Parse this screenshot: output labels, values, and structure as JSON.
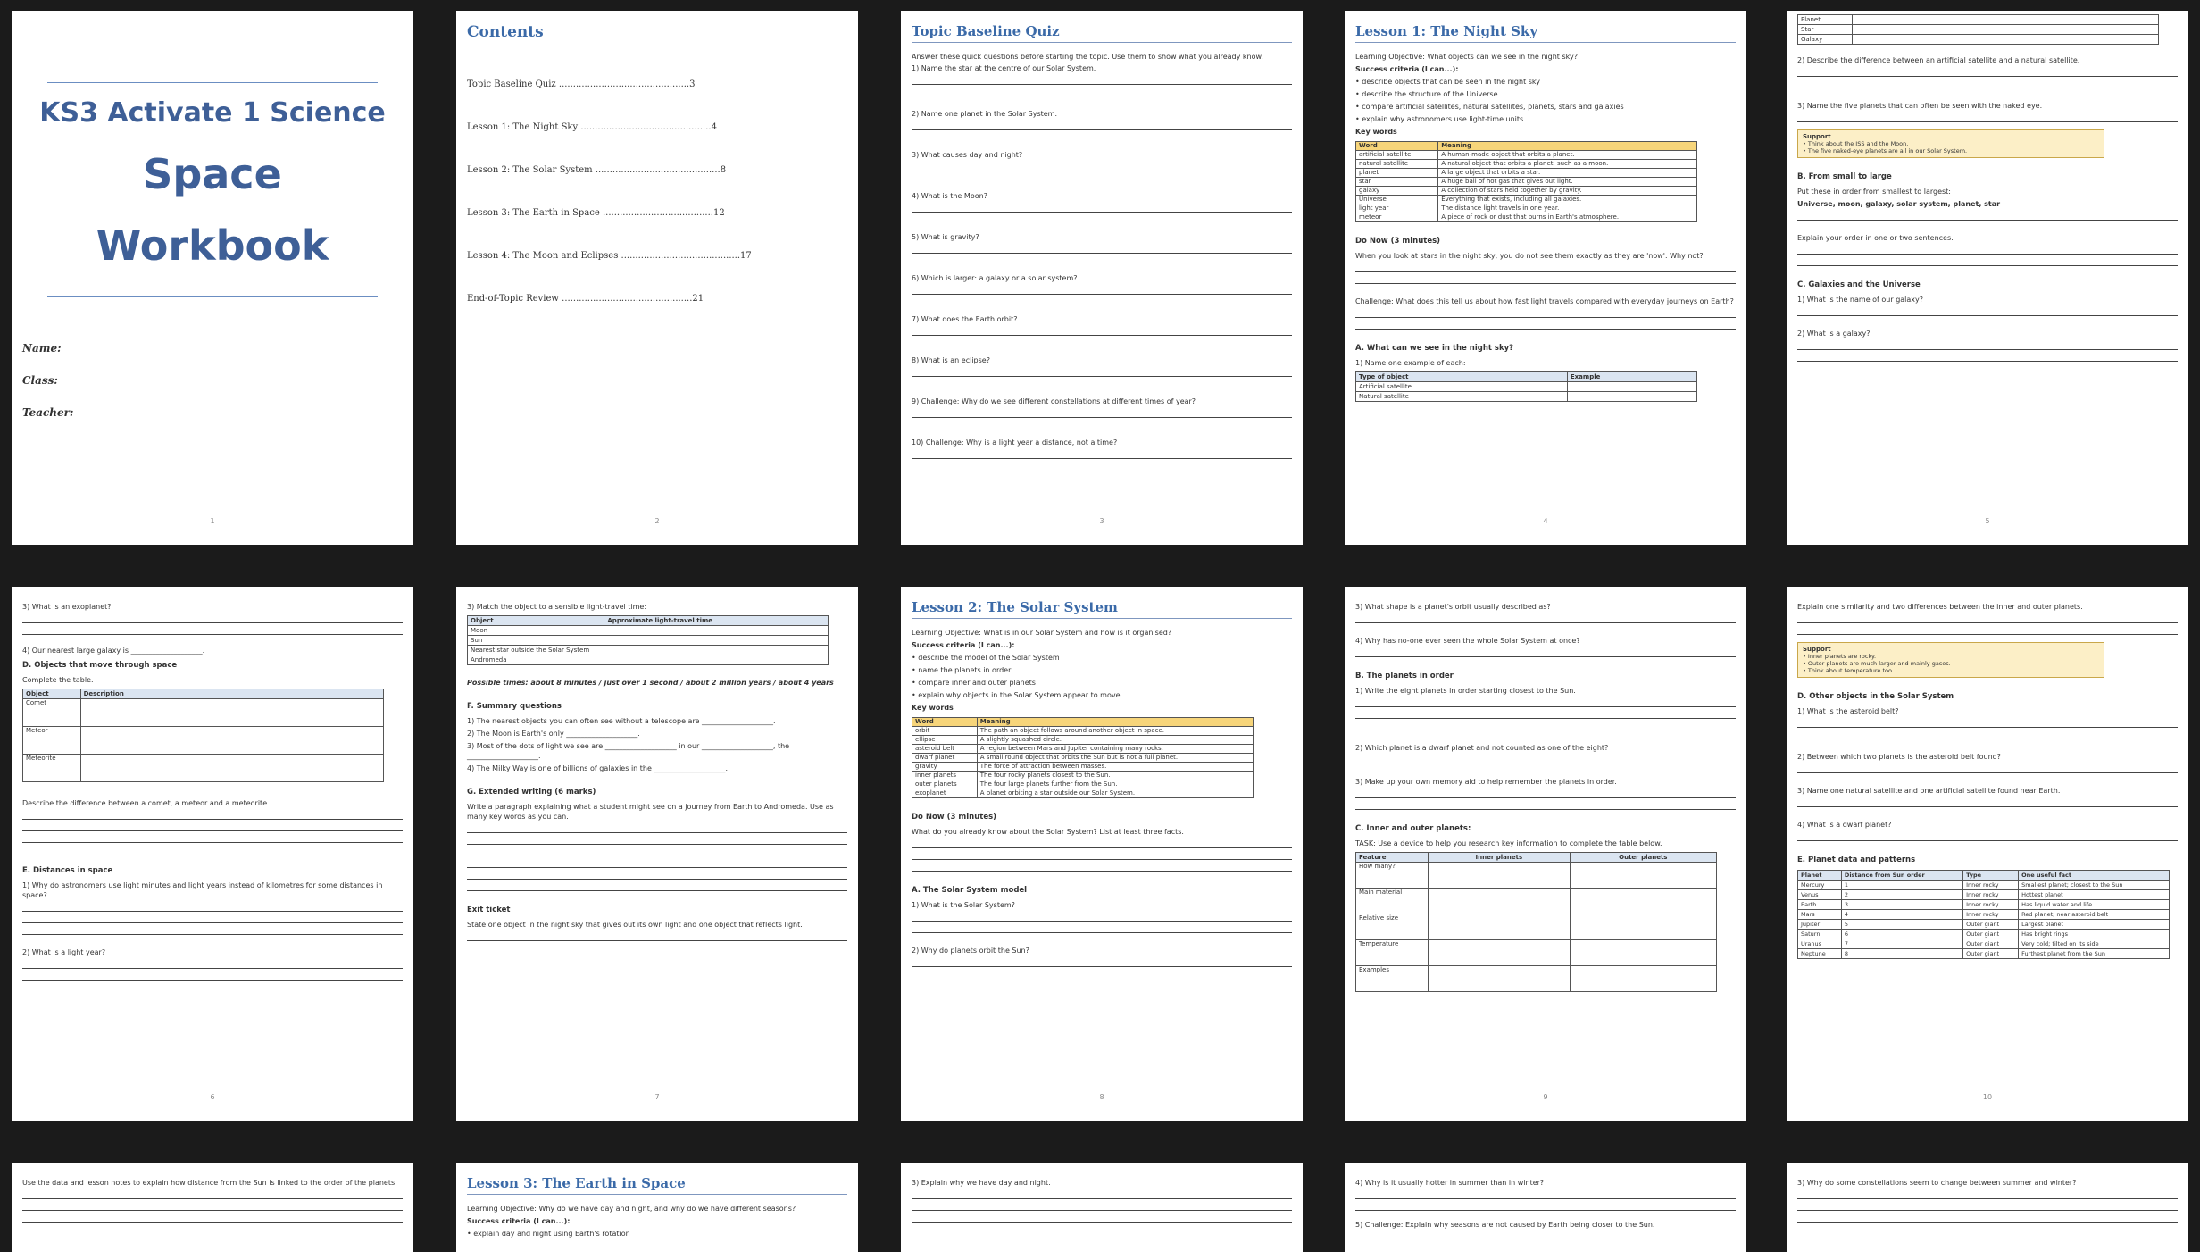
{
  "cover": {
    "course": "KS3 Activate 1 Science",
    "title_line1": "Space",
    "title_line2": "Workbook",
    "fields": [
      "Name:",
      "Class:",
      "Teacher:"
    ],
    "page": "1"
  },
  "contents": {
    "title": "Contents",
    "items": [
      {
        "label": "Topic Baseline Quiz",
        "page": "3"
      },
      {
        "label": "Lesson 1: The Night Sky",
        "page": "4"
      },
      {
        "label": "Lesson 2: The Solar System",
        "page": "8"
      },
      {
        "label": "Lesson 3: The Earth in Space",
        "page": "12"
      },
      {
        "label": "Lesson 4: The Moon and Eclipses",
        "page": "17"
      },
      {
        "label": "End-of-Topic Review",
        "page": "21"
      }
    ],
    "page": "2"
  },
  "quiz": {
    "title": "Topic Baseline Quiz",
    "intro": "Answer these quick questions before starting the topic. Use them to show what you already know.",
    "questions": [
      "1) Name the star at the centre of our Solar System.",
      "2) Name one planet in the Solar System.",
      "3) What causes day and night?",
      "4) What is the Moon?",
      "5) What is gravity?",
      "6) Which is larger: a galaxy or a solar system?",
      "7) What does the Earth orbit?",
      "8) What is an eclipse?",
      "9) Challenge: Why do we see different constellations at different times of year?",
      "10) Challenge: Why is a light year a distance, not a time?"
    ],
    "page": "3"
  },
  "lesson1": {
    "title": "Lesson 1: The Night Sky",
    "objective": "Learning Objective: What objects can we see in the night sky?",
    "criteria_head": "Success criteria (I can...):",
    "criteria": [
      "• describe objects that can be seen in the night sky",
      "• describe the structure of the Universe",
      "• compare artificial satellites, natural satellites, planets, stars and galaxies",
      "• explain why astronomers use light-time units"
    ],
    "keywords_head": "Key words",
    "kw_cols": [
      "Word",
      "Meaning"
    ],
    "keywords": [
      [
        "artificial satellite",
        "A human-made object that orbits a planet."
      ],
      [
        "natural satellite",
        "A natural object that orbits a planet, such as a moon."
      ],
      [
        "planet",
        "A large object that orbits a star."
      ],
      [
        "star",
        "A huge ball of hot gas that gives out light."
      ],
      [
        "galaxy",
        "A collection of stars held together by gravity."
      ],
      [
        "Universe",
        "Everything that exists, including all galaxies."
      ],
      [
        "light year",
        "The distance light travels in one year."
      ],
      [
        "meteor",
        "A piece of rock or dust that burns in Earth's atmosphere."
      ]
    ],
    "donow_head": "Do Now (3 minutes)",
    "donow": "When you look at stars in the night sky, you do not see them exactly as they are 'now'. Why not?",
    "challenge": "Challenge: What does this tell us about how fast light travels compared with everyday journeys on Earth?",
    "section_a": "A. What can we see in the night sky?",
    "a_q1": "1) Name one example of each:",
    "a_cols": [
      "Type of object",
      "Example"
    ],
    "a_rows": [
      "Artificial satellite",
      "Natural satellite"
    ],
    "page": "4"
  },
  "p5": {
    "rows": [
      "Planet",
      "Star",
      "Galaxy"
    ],
    "q2": "2) Describe the difference between an artificial satellite and a natural satellite.",
    "q3": "3) Name the five planets that can often be seen with the naked eye.",
    "support_head": "Support",
    "support": [
      "• Think about the ISS and the Moon.",
      "• The five naked-eye planets are all in our Solar System."
    ],
    "section_b": "B. From small to large",
    "b_intro": "Put these in order from smallest to largest:",
    "b_list": "Universe, moon, galaxy, solar system, planet, star",
    "b_explain": "Explain your order in one or two sentences.",
    "section_c": "C. Galaxies and the Universe",
    "c_q1": "1) What is the name of our galaxy?",
    "c_q2": "2) What is a galaxy?",
    "page": "5"
  },
  "p6": {
    "q3": "3) What is an exoplanet?",
    "q4": "4) Our nearest large galaxy is ____________________.",
    "section_d": "D. Objects that move through space",
    "d_intro": "Complete the table.",
    "d_cols": [
      "Object",
      "Description"
    ],
    "d_rows": [
      "Comet",
      "Meteor",
      "Meteorite"
    ],
    "d_q": "Describe the difference between a comet, a meteor and a meteorite.",
    "section_e": "E. Distances in space",
    "e_q1": "1) Why do astronomers use light minutes and light years instead of kilometres for some distances in space?",
    "e_q2": "2) What is a light year?",
    "page": "6"
  },
  "p7": {
    "q3": "3) Match the object to a sensible light-travel time:",
    "cols": [
      "Object",
      "Approximate light-travel time"
    ],
    "rows": [
      "Moon",
      "Sun",
      "Nearest star outside the Solar System",
      "Andromeda"
    ],
    "times": "Possible times: about 8 minutes / just over 1 second / about 2 million years / about 4 years",
    "section_f": "F. Summary questions",
    "f_qs": [
      "1) The nearest objects you can often see without a telescope are ____________________.",
      "2) The Moon is Earth's only ____________________.",
      "3) Most of the dots of light we see are ____________________ in our ____________________, the ____________________.",
      "4) The Milky Way is one of billions of galaxies in the ____________________."
    ],
    "section_g": "G. Extended writing (6 marks)",
    "g_text": "Write a paragraph explaining what a student might see on a journey from Earth to Andromeda. Use as many key words as you can.",
    "exit_head": "Exit ticket",
    "exit": "State one object in the night sky that gives out its own light and one object that reflects light.",
    "page": "7"
  },
  "lesson2": {
    "title": "Lesson 2: The Solar System",
    "objective": "Learning Objective: What is in our Solar System and how is it organised?",
    "criteria_head": "Success criteria (I can...):",
    "criteria": [
      "• describe the model of the Solar System",
      "• name the planets in order",
      "• compare inner and outer planets",
      "• explain why objects in the Solar System appear to move"
    ],
    "keywords_head": "Key words",
    "kw_cols": [
      "Word",
      "Meaning"
    ],
    "keywords": [
      [
        "orbit",
        "The path an object follows around another object in space."
      ],
      [
        "ellipse",
        "A slightly squashed circle."
      ],
      [
        "asteroid belt",
        "A region between Mars and Jupiter containing many rocks."
      ],
      [
        "dwarf planet",
        "A small round object that orbits the Sun but is not a full planet."
      ],
      [
        "gravity",
        "The force of attraction between masses."
      ],
      [
        "inner planets",
        "The four rocky planets closest to the Sun."
      ],
      [
        "outer planets",
        "The four large planets further from the Sun."
      ],
      [
        "exoplanet",
        "A planet orbiting a star outside our Solar System."
      ]
    ],
    "donow_head": "Do Now (3 minutes)",
    "donow": "What do you already know about the Solar System? List at least three facts.",
    "section_a": "A. The Solar System model",
    "a_q1": "1) What is the Solar System?",
    "a_q2": "2) Why do planets orbit the Sun?",
    "page": "8"
  },
  "p9": {
    "q3": "3) What shape is a planet's orbit usually described as?",
    "q4": "4) Why has no-one ever seen the whole Solar System at once?",
    "section_b": "B. The planets in order",
    "b_q1": "1) Write the eight planets in order starting closest to the Sun.",
    "b_q2": "2) Which planet is a dwarf planet and not counted as one of the eight?",
    "b_q3": "3) Make up your own memory aid to help remember the planets in order.",
    "section_c": "C. Inner and outer planets:",
    "task": "TASK: Use a device to help you research key information to complete the table below.",
    "c_cols": [
      "Feature",
      "Inner planets",
      "Outer planets"
    ],
    "c_rows": [
      "How many?",
      "Main material",
      "Relative size",
      "Temperature",
      "Examples"
    ],
    "page": "9"
  },
  "p10": {
    "q_top": "Explain one similarity and two differences between the inner and outer planets.",
    "support_head": "Support",
    "support": [
      "• Inner planets are rocky.",
      "• Outer planets are much larger and mainly gases.",
      "• Think about temperature too."
    ],
    "section_d": "D. Other objects in the Solar System",
    "d_q1": "1) What is the asteroid belt?",
    "d_q2": "2) Between which two planets is the asteroid belt found?",
    "d_q3": "3) Name one natural satellite and one artificial satellite found near Earth.",
    "d_q4": "4) What is a dwarf planet?",
    "section_e": "E. Planet data and patterns",
    "e_cols": [
      "Planet",
      "Distance from Sun order",
      "Type",
      "One useful fact"
    ],
    "e_rows": [
      [
        "Mercury",
        "1",
        "Inner rocky",
        "Smallest planet; closest to the Sun"
      ],
      [
        "Venus",
        "2",
        "Inner rocky",
        "Hottest planet"
      ],
      [
        "Earth",
        "3",
        "Inner rocky",
        "Has liquid water and life"
      ],
      [
        "Mars",
        "4",
        "Inner rocky",
        "Red planet; near asteroid belt"
      ],
      [
        "Jupiter",
        "5",
        "Outer giant",
        "Largest planet"
      ],
      [
        "Saturn",
        "6",
        "Outer giant",
        "Has bright rings"
      ],
      [
        "Uranus",
        "7",
        "Outer giant",
        "Very cold; tilted on its side"
      ],
      [
        "Neptune",
        "8",
        "Outer giant",
        "Furthest planet from the Sun"
      ]
    ],
    "page": "10"
  },
  "p11": {
    "q": "Use the data and lesson notes to explain how distance from the Sun is linked to the order of the planets."
  },
  "lesson3": {
    "title": "Lesson 3: The Earth in Space",
    "objective": "Learning Objective: Why do we have day and night, and why do we have different seasons?",
    "criteria_head": "Success criteria (I can...):",
    "criteria": [
      "• explain day and night using Earth's rotation"
    ]
  },
  "p13": {
    "q": "3) Explain why we have day and night."
  },
  "p14": {
    "q4": "4) Why is it usually hotter in summer than in winter?",
    "q5": "5) Challenge: Explain why seasons are not caused by Earth being closer to the Sun."
  },
  "p15": {
    "q3": "3) Why do some constellations seem to change between summer and winter?"
  }
}
